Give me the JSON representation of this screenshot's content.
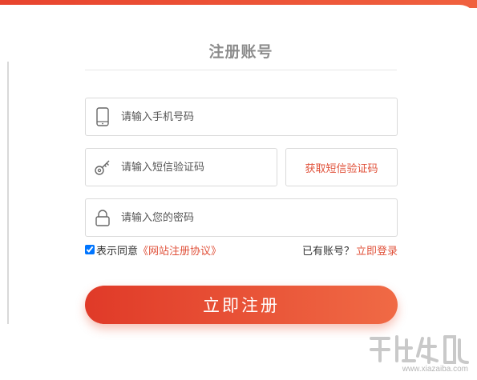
{
  "form": {
    "title": "注册账号",
    "phone_placeholder": "请输入手机号码",
    "sms_placeholder": "请输入短信验证码",
    "sms_button_label": "获取短信验证码",
    "password_placeholder": "请输入您的密码",
    "agree_prefix": "表示同意",
    "agree_link": "《网站注册协议》",
    "agree_checked": true,
    "have_account_text": "已有账号？",
    "login_link": "立即登录",
    "register_button_label": "立即注册"
  },
  "watermark": {
    "text": "www.xiazaiba.com"
  },
  "colors": {
    "accent": "#e0513a",
    "button_start": "#e03a28",
    "button_end": "#f06a45",
    "border": "#dadada",
    "title": "#8c8c8c"
  },
  "icons": {
    "phone": "phone-icon",
    "sms": "key-icon",
    "password": "lock-icon"
  }
}
